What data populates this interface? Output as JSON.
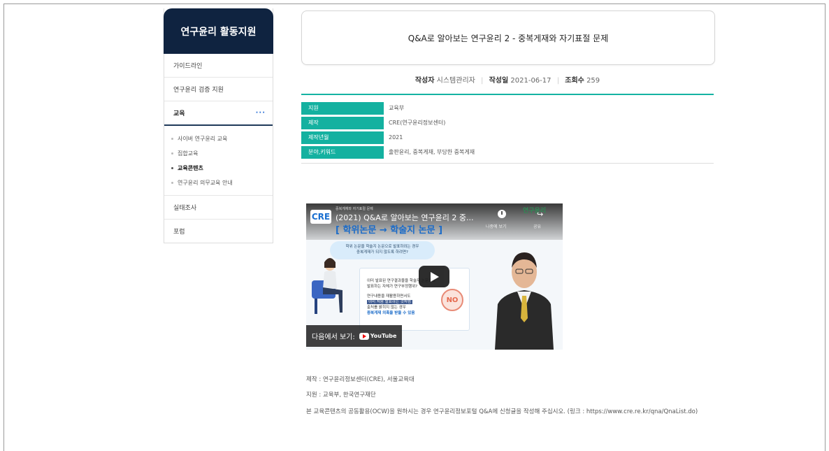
{
  "sidebar": {
    "title": "연구윤리 활동지원",
    "items": [
      {
        "label": "가이드라인"
      },
      {
        "label": "연구윤리 검증 지원"
      },
      {
        "label": "교육",
        "more": "···"
      },
      {
        "label": "실태조사"
      },
      {
        "label": "포럼"
      }
    ],
    "sub_items": [
      {
        "label": "사이버 연구윤리 교육"
      },
      {
        "label": "집합교육"
      },
      {
        "label": "교육콘텐츠"
      },
      {
        "label": "연구윤리 의무교육 안내"
      }
    ]
  },
  "post": {
    "title": "Q&A로 알아보는 연구윤리 2 - 중복게재와 자기표절 문제",
    "author_label": "작성자",
    "author": "시스템관리자",
    "date_label": "작성일",
    "date": "2021-06-17",
    "views_label": "조회수",
    "views": "259"
  },
  "info": [
    {
      "label": "지원",
      "value": "교육부"
    },
    {
      "label": "제작",
      "value": "CRE(연구윤리정보센터)"
    },
    {
      "label": "제작년월",
      "value": "2021"
    },
    {
      "label": "분야,키워드",
      "value": "출판윤리, 중복게재, 부당한 중복게재"
    }
  ],
  "video": {
    "channel_badge": "CRE",
    "small_caption": "중복게재와 자기표절 문제",
    "title": "(2021) Q&A로 알아보는 연구윤리 2 중...",
    "watch_later": "나중에 보기",
    "share": "공유",
    "logo_text": "연구윤리",
    "heading": "[ 학위논문 → 학술지 논문 ]",
    "bubble_line1": "학위 논문을 학술지 논문으로 발표하려는 경우",
    "bubble_line2": "중복게재가 되지 않도록 하려면?",
    "panel_line1": "이미 발표된 연구결과물을 학술지 논문으로",
    "panel_line2": "발표하는 자체가 연구부정행위?",
    "panel_line3": "연구내용을 재활용하면서도",
    "panel_line4": "이미 처음 발표하는 것처럼",
    "panel_line5": "출처를 밝히지 않는 경우",
    "panel_line6": "중복게재 의혹을 받을 수 있음",
    "no_badge": "NO",
    "watch_on": "다음에서 보기:",
    "youtube": "YouTube"
  },
  "footer": {
    "production": "제작 : 연구윤리정보센터(CRE), 서울교육대",
    "support": "지원 : 교육부, 한국연구재단",
    "ocw_notice": "본 교육콘텐츠의 공동활용(OCW)을 원하시는 경우 연구윤리정보포털 Q&A에 신청글을 작성해 주십시오. (링크 :   https://www.cre.re.kr/qna/QnaList.do)"
  }
}
